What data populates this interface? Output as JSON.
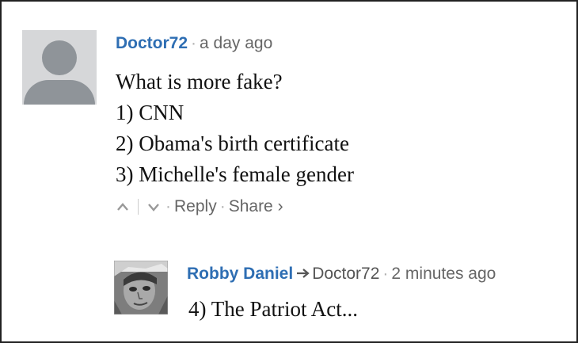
{
  "comments": [
    {
      "author": "Doctor72",
      "time": "a day ago",
      "lines": [
        "What is more fake?",
        "1) CNN",
        "2) Obama's birth certificate",
        "3) Michelle's female gender"
      ],
      "actions": {
        "upvote_icon": "chevron-up-icon",
        "downvote_icon": "chevron-down-icon",
        "reply": "Reply",
        "share": "Share",
        "share_icon": "chevron-right-icon"
      }
    },
    {
      "author": "Robby Daniel",
      "reply_to": "Doctor72",
      "reply_icon": "arrow-right-icon",
      "time": "2 minutes ago",
      "lines": [
        "4) The Patriot Act..."
      ]
    }
  ],
  "colors": {
    "author": "#2e6eb3",
    "meta": "#888888",
    "avatar_placeholder": "#d6d7d9"
  }
}
